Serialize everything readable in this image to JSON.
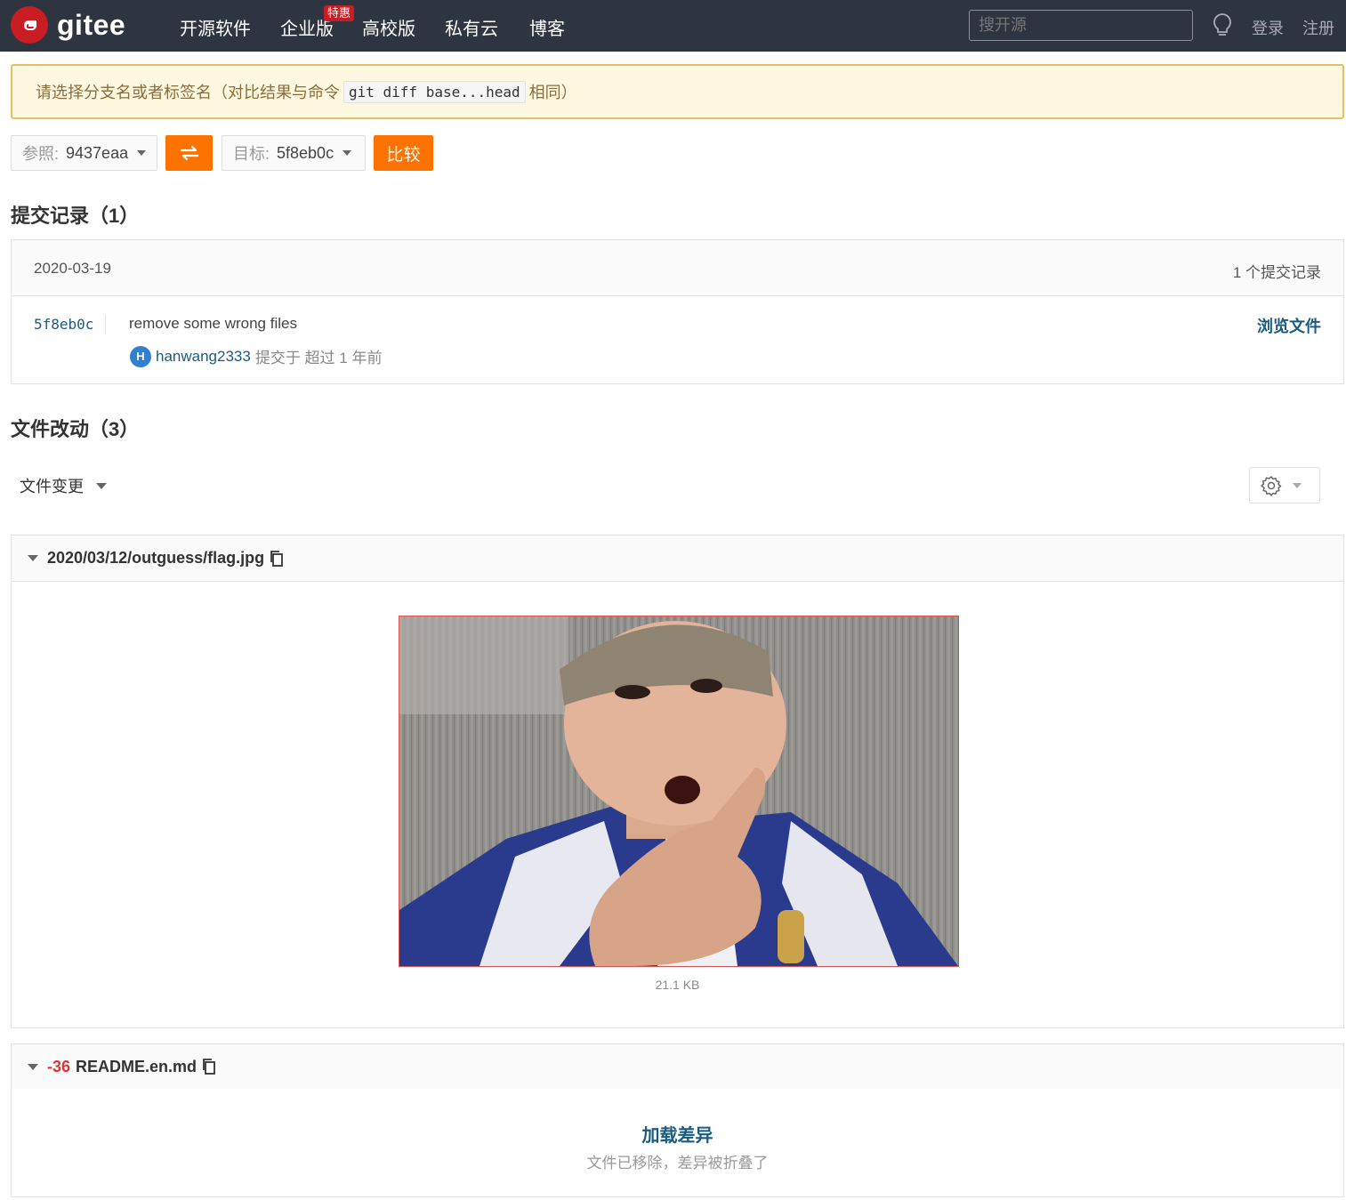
{
  "header": {
    "logo_text": "gitee",
    "nav": [
      "开源软件",
      "企业版",
      "高校版",
      "私有云",
      "博客"
    ],
    "promo_badge": "特惠",
    "search_placeholder": "搜开源",
    "login": "登录",
    "register": "注册"
  },
  "notice": {
    "prefix": "请选择分支名或者标签名（对比结果与命令",
    "command": "git diff base...head",
    "suffix": "相同）"
  },
  "compare": {
    "base_label": "参照:",
    "base_value": "9437eaa",
    "target_label": "目标:",
    "target_value": "5f8eb0c",
    "compare_button": "比较"
  },
  "commits": {
    "title": "提交记录（1）",
    "date": "2020-03-19",
    "count_text": "1 个提交记录",
    "items": [
      {
        "sha": "5f8eb0c",
        "message": "remove some wrong files",
        "avatar_letter": "H",
        "author": "hanwang2333",
        "meta": "提交于 超过 1 年前",
        "browse": "浏览文件"
      }
    ]
  },
  "files": {
    "title": "文件改动（3）",
    "filter_label": "文件变更",
    "items": [
      {
        "path": "2020/03/12/outguess/flag.jpg",
        "size": "21.1 KB"
      },
      {
        "deletions": "-36",
        "path": "README.en.md",
        "load_diff": "加载差异",
        "collapsed_note": "文件已移除，差异被折叠了"
      }
    ]
  },
  "colors": {
    "topbar": "#2f3441",
    "brand": "#c71d23",
    "accent_orange": "#fe7300",
    "link": "#1b5b80"
  },
  "icons": [
    "gitee-logo-icon",
    "lightbulb-icon",
    "swap-icon",
    "caret-down-icon",
    "gear-icon",
    "copy-icon",
    "collapse-triangle-icon"
  ]
}
